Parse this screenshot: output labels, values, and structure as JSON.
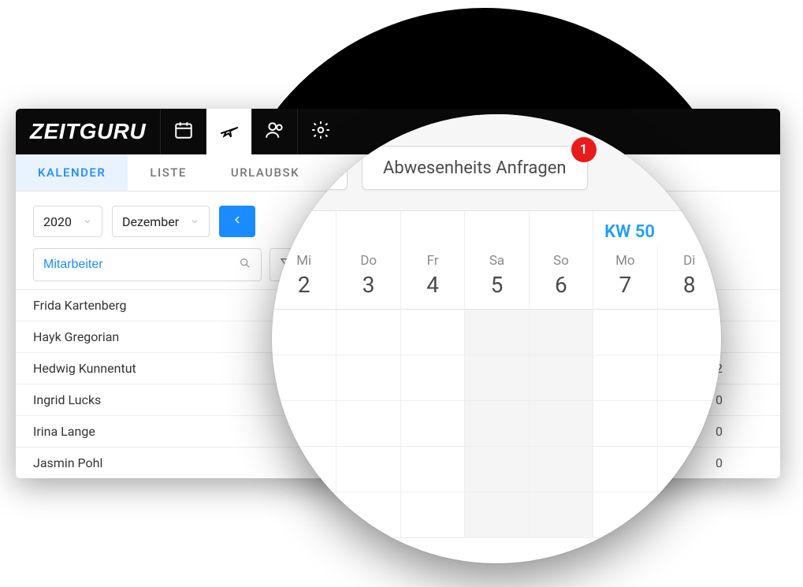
{
  "brand": "ZEITGURU",
  "subtabs": [
    {
      "label": "KALENDER",
      "active": true
    },
    {
      "label": "LISTE",
      "active": false
    },
    {
      "label": "URLAUBSK",
      "active": false
    }
  ],
  "filters": {
    "year": "2020",
    "month": "Dezember"
  },
  "search": {
    "placeholder": "Mitarbeiter"
  },
  "employees": [
    {
      "name": "Frida Kartenberg",
      "value": ""
    },
    {
      "name": "Hayk Gregorian",
      "value": ""
    },
    {
      "name": "Hedwig Kunnentut",
      "value": "2"
    },
    {
      "name": "Ingrid Lucks",
      "value": "0"
    },
    {
      "name": "Irina Lange",
      "value": "0"
    },
    {
      "name": "Jasmin Pohl",
      "value": "0"
    }
  ],
  "magnifier": {
    "requests_button": "Abwesenheits Anfragen",
    "badge": "1",
    "week_label": "KW 50",
    "days": [
      {
        "name": "Mi",
        "num": "2",
        "weekend": false
      },
      {
        "name": "Do",
        "num": "3",
        "weekend": false
      },
      {
        "name": "Fr",
        "num": "4",
        "weekend": false
      },
      {
        "name": "Sa",
        "num": "5",
        "weekend": true
      },
      {
        "name": "So",
        "num": "6",
        "weekend": true
      },
      {
        "name": "Mo",
        "num": "7",
        "weekend": false
      },
      {
        "name": "Di",
        "num": "8",
        "weekend": false
      }
    ]
  }
}
